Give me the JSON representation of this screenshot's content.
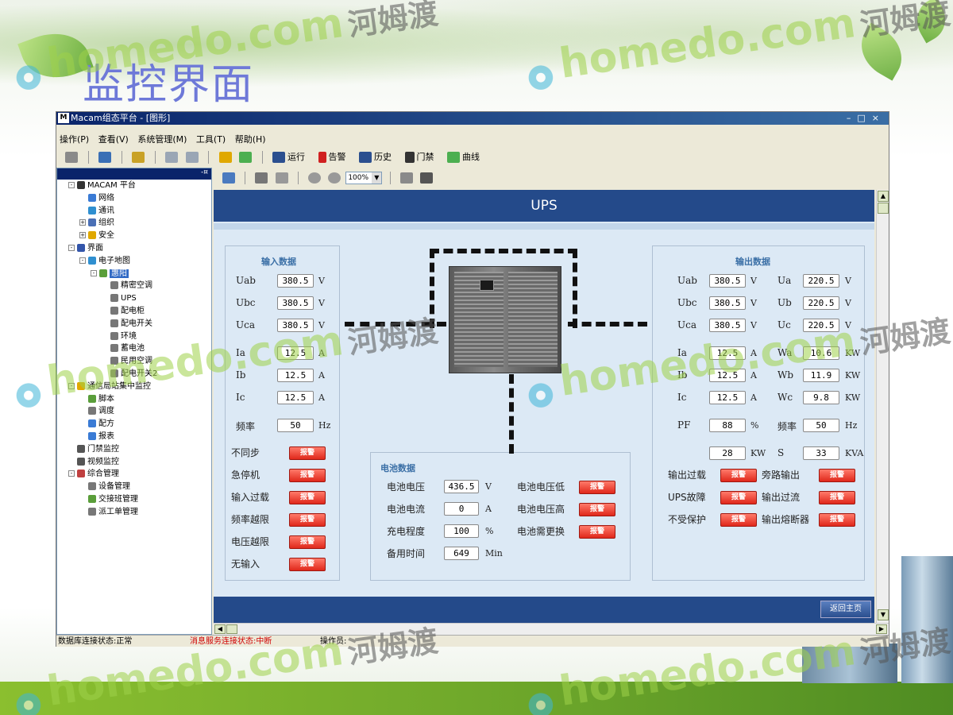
{
  "slide": {
    "title": "监控界面"
  },
  "watermark": {
    "en": "homedo.com",
    "cn": "河姆渡"
  },
  "window": {
    "title": "Macam组态平台 - [图形]",
    "app_icon": "M",
    "controls": "–□×"
  },
  "menu": [
    "操作(P)",
    "查看(V)",
    "系统管理(M)",
    "工具(T)",
    "帮助(H)"
  ],
  "toolbar": {
    "run": "运行",
    "alarm": "告警",
    "history": "历史",
    "door": "门禁",
    "curve": "曲线"
  },
  "tree": {
    "pin": "-¤",
    "items": [
      {
        "label": "MACAM 平台",
        "level": 0,
        "expander": "-",
        "icon": "logo-icon",
        "color": "#333333"
      },
      {
        "label": "网络",
        "level": 1,
        "expander": "",
        "icon": "network-icon",
        "color": "#3a7bd5"
      },
      {
        "label": "通讯",
        "level": 1,
        "expander": "",
        "icon": "globe-icon",
        "color": "#2f8fd0"
      },
      {
        "label": "组织",
        "level": 1,
        "expander": "+",
        "icon": "org-icon",
        "color": "#4a6fb5"
      },
      {
        "label": "安全",
        "level": 1,
        "expander": "+",
        "icon": "lock-icon",
        "color": "#e0a800"
      },
      {
        "label": "界面",
        "level": 0,
        "expander": "-",
        "icon": "monitor-icon",
        "color": "#3355aa"
      },
      {
        "label": "电子地图",
        "level": 1,
        "expander": "-",
        "icon": "map-icon",
        "color": "#2f8fd0"
      },
      {
        "label": "惠阳",
        "level": 2,
        "expander": "-",
        "icon": "folder-icon",
        "color": "#5a9e3a",
        "selected": true
      },
      {
        "label": "精密空调",
        "level": 3,
        "expander": "",
        "icon": "page-icon",
        "color": "#777777"
      },
      {
        "label": "UPS",
        "level": 3,
        "expander": "",
        "icon": "page-icon",
        "color": "#777777"
      },
      {
        "label": "配电柜",
        "level": 3,
        "expander": "",
        "icon": "page-icon",
        "color": "#777777"
      },
      {
        "label": "配电开关",
        "level": 3,
        "expander": "",
        "icon": "page-icon",
        "color": "#777777"
      },
      {
        "label": "环境",
        "level": 3,
        "expander": "",
        "icon": "page-icon",
        "color": "#777777"
      },
      {
        "label": "蓄电池",
        "level": 3,
        "expander": "",
        "icon": "page-icon",
        "color": "#777777"
      },
      {
        "label": "民用空调",
        "level": 3,
        "expander": "",
        "icon": "page-icon",
        "color": "#777777"
      },
      {
        "label": "配电开关2",
        "level": 3,
        "expander": "",
        "icon": "page-icon",
        "color": "#777777"
      },
      {
        "label": "通信局站集中监控",
        "level": 0,
        "expander": "-",
        "icon": "gear-icon",
        "color": "#e0a800"
      },
      {
        "label": "脚本",
        "level": 1,
        "expander": "",
        "icon": "script-icon",
        "color": "#5a9e3a"
      },
      {
        "label": "调度",
        "level": 1,
        "expander": "",
        "icon": "schedule-icon",
        "color": "#777777"
      },
      {
        "label": "配方",
        "level": 1,
        "expander": "",
        "icon": "recipe-icon",
        "color": "#3a7bd5"
      },
      {
        "label": "报表",
        "level": 1,
        "expander": "",
        "icon": "report-icon",
        "color": "#3a7bd5"
      },
      {
        "label": "门禁监控",
        "level": 0,
        "expander": "",
        "icon": "door-icon",
        "color": "#555555"
      },
      {
        "label": "视频监控",
        "level": 0,
        "expander": "",
        "icon": "camera-icon",
        "color": "#555555"
      },
      {
        "label": "综合管理",
        "level": 0,
        "expander": "-",
        "icon": "manage-icon",
        "color": "#c04040"
      },
      {
        "label": "设备管理",
        "level": 1,
        "expander": "",
        "icon": "device-icon",
        "color": "#777777"
      },
      {
        "label": "交接班管理",
        "level": 1,
        "expander": "",
        "icon": "shift-icon",
        "color": "#5a9e3a"
      },
      {
        "label": "派工单管理",
        "level": 1,
        "expander": "",
        "icon": "order-icon",
        "color": "#777777"
      }
    ]
  },
  "viewer_toolbar": {
    "zoom": "100%"
  },
  "ups": {
    "title": "UPS",
    "back_button": "返回主页",
    "input": {
      "title": "输入数据",
      "rows": [
        {
          "label": "Uab",
          "value": "380.5",
          "unit": "V"
        },
        {
          "label": "Ubc",
          "value": "380.5",
          "unit": "V"
        },
        {
          "label": "Uca",
          "value": "380.5",
          "unit": "V"
        },
        {
          "label": "Ia",
          "value": "12.5",
          "unit": "A"
        },
        {
          "label": "Ib",
          "value": "12.5",
          "unit": "A"
        },
        {
          "label": "Ic",
          "value": "12.5",
          "unit": "A"
        },
        {
          "label": "频率",
          "value": "50",
          "unit": "Hz"
        }
      ],
      "alarms": [
        "不同步",
        "急停机",
        "输入过载",
        "频率越限",
        "电压越限",
        "无输入"
      ]
    },
    "battery": {
      "title": "电池数据",
      "rows": [
        {
          "label": "电池电压",
          "value": "436.5",
          "unit": "V"
        },
        {
          "label": "电池电流",
          "value": "0",
          "unit": "A"
        },
        {
          "label": "充电程度",
          "value": "100",
          "unit": "%"
        },
        {
          "label": "备用时间",
          "value": "649",
          "unit": "Min"
        }
      ],
      "alarms": [
        "电池电压低",
        "电池电压高",
        "电池需更换"
      ]
    },
    "output": {
      "title": "输出数据",
      "left": [
        {
          "label": "Uab",
          "value": "380.5",
          "unit": "V"
        },
        {
          "label": "Ubc",
          "value": "380.5",
          "unit": "V"
        },
        {
          "label": "Uca",
          "value": "380.5",
          "unit": "V"
        },
        {
          "label": "Ia",
          "value": "12.5",
          "unit": "A"
        },
        {
          "label": "Ib",
          "value": "12.5",
          "unit": "A"
        },
        {
          "label": "Ic",
          "value": "12.5",
          "unit": "A"
        },
        {
          "label": "PF",
          "value": "88",
          "unit": "%"
        },
        {
          "label": "",
          "value": "28",
          "unit": "KW"
        }
      ],
      "right": [
        {
          "label": "Ua",
          "value": "220.5",
          "unit": "V"
        },
        {
          "label": "Ub",
          "value": "220.5",
          "unit": "V"
        },
        {
          "label": "Uc",
          "value": "220.5",
          "unit": "V"
        },
        {
          "label": "Wa",
          "value": "10.6",
          "unit": "KW"
        },
        {
          "label": "Wb",
          "value": "11.9",
          "unit": "KW"
        },
        {
          "label": "Wc",
          "value": "9.8",
          "unit": "KW"
        },
        {
          "label": "频率",
          "value": "50",
          "unit": "Hz"
        },
        {
          "label": "S",
          "value": "33",
          "unit": "KVA"
        }
      ],
      "alarms_left": [
        "输出过载",
        "UPS故障",
        "不受保护"
      ],
      "alarms_right": [
        "旁路输出",
        "输出过流",
        "输出熔断器"
      ]
    },
    "alarm_label": "报警"
  },
  "status": {
    "db": "数据库连接状态:正常",
    "msg": "消息服务连接状态:中断",
    "operator": "操作员:"
  },
  "colors": {
    "header": "#244a8a",
    "panel": "#dce9f5",
    "alarm": "#e0281b",
    "title_text": "#6e79d8"
  }
}
